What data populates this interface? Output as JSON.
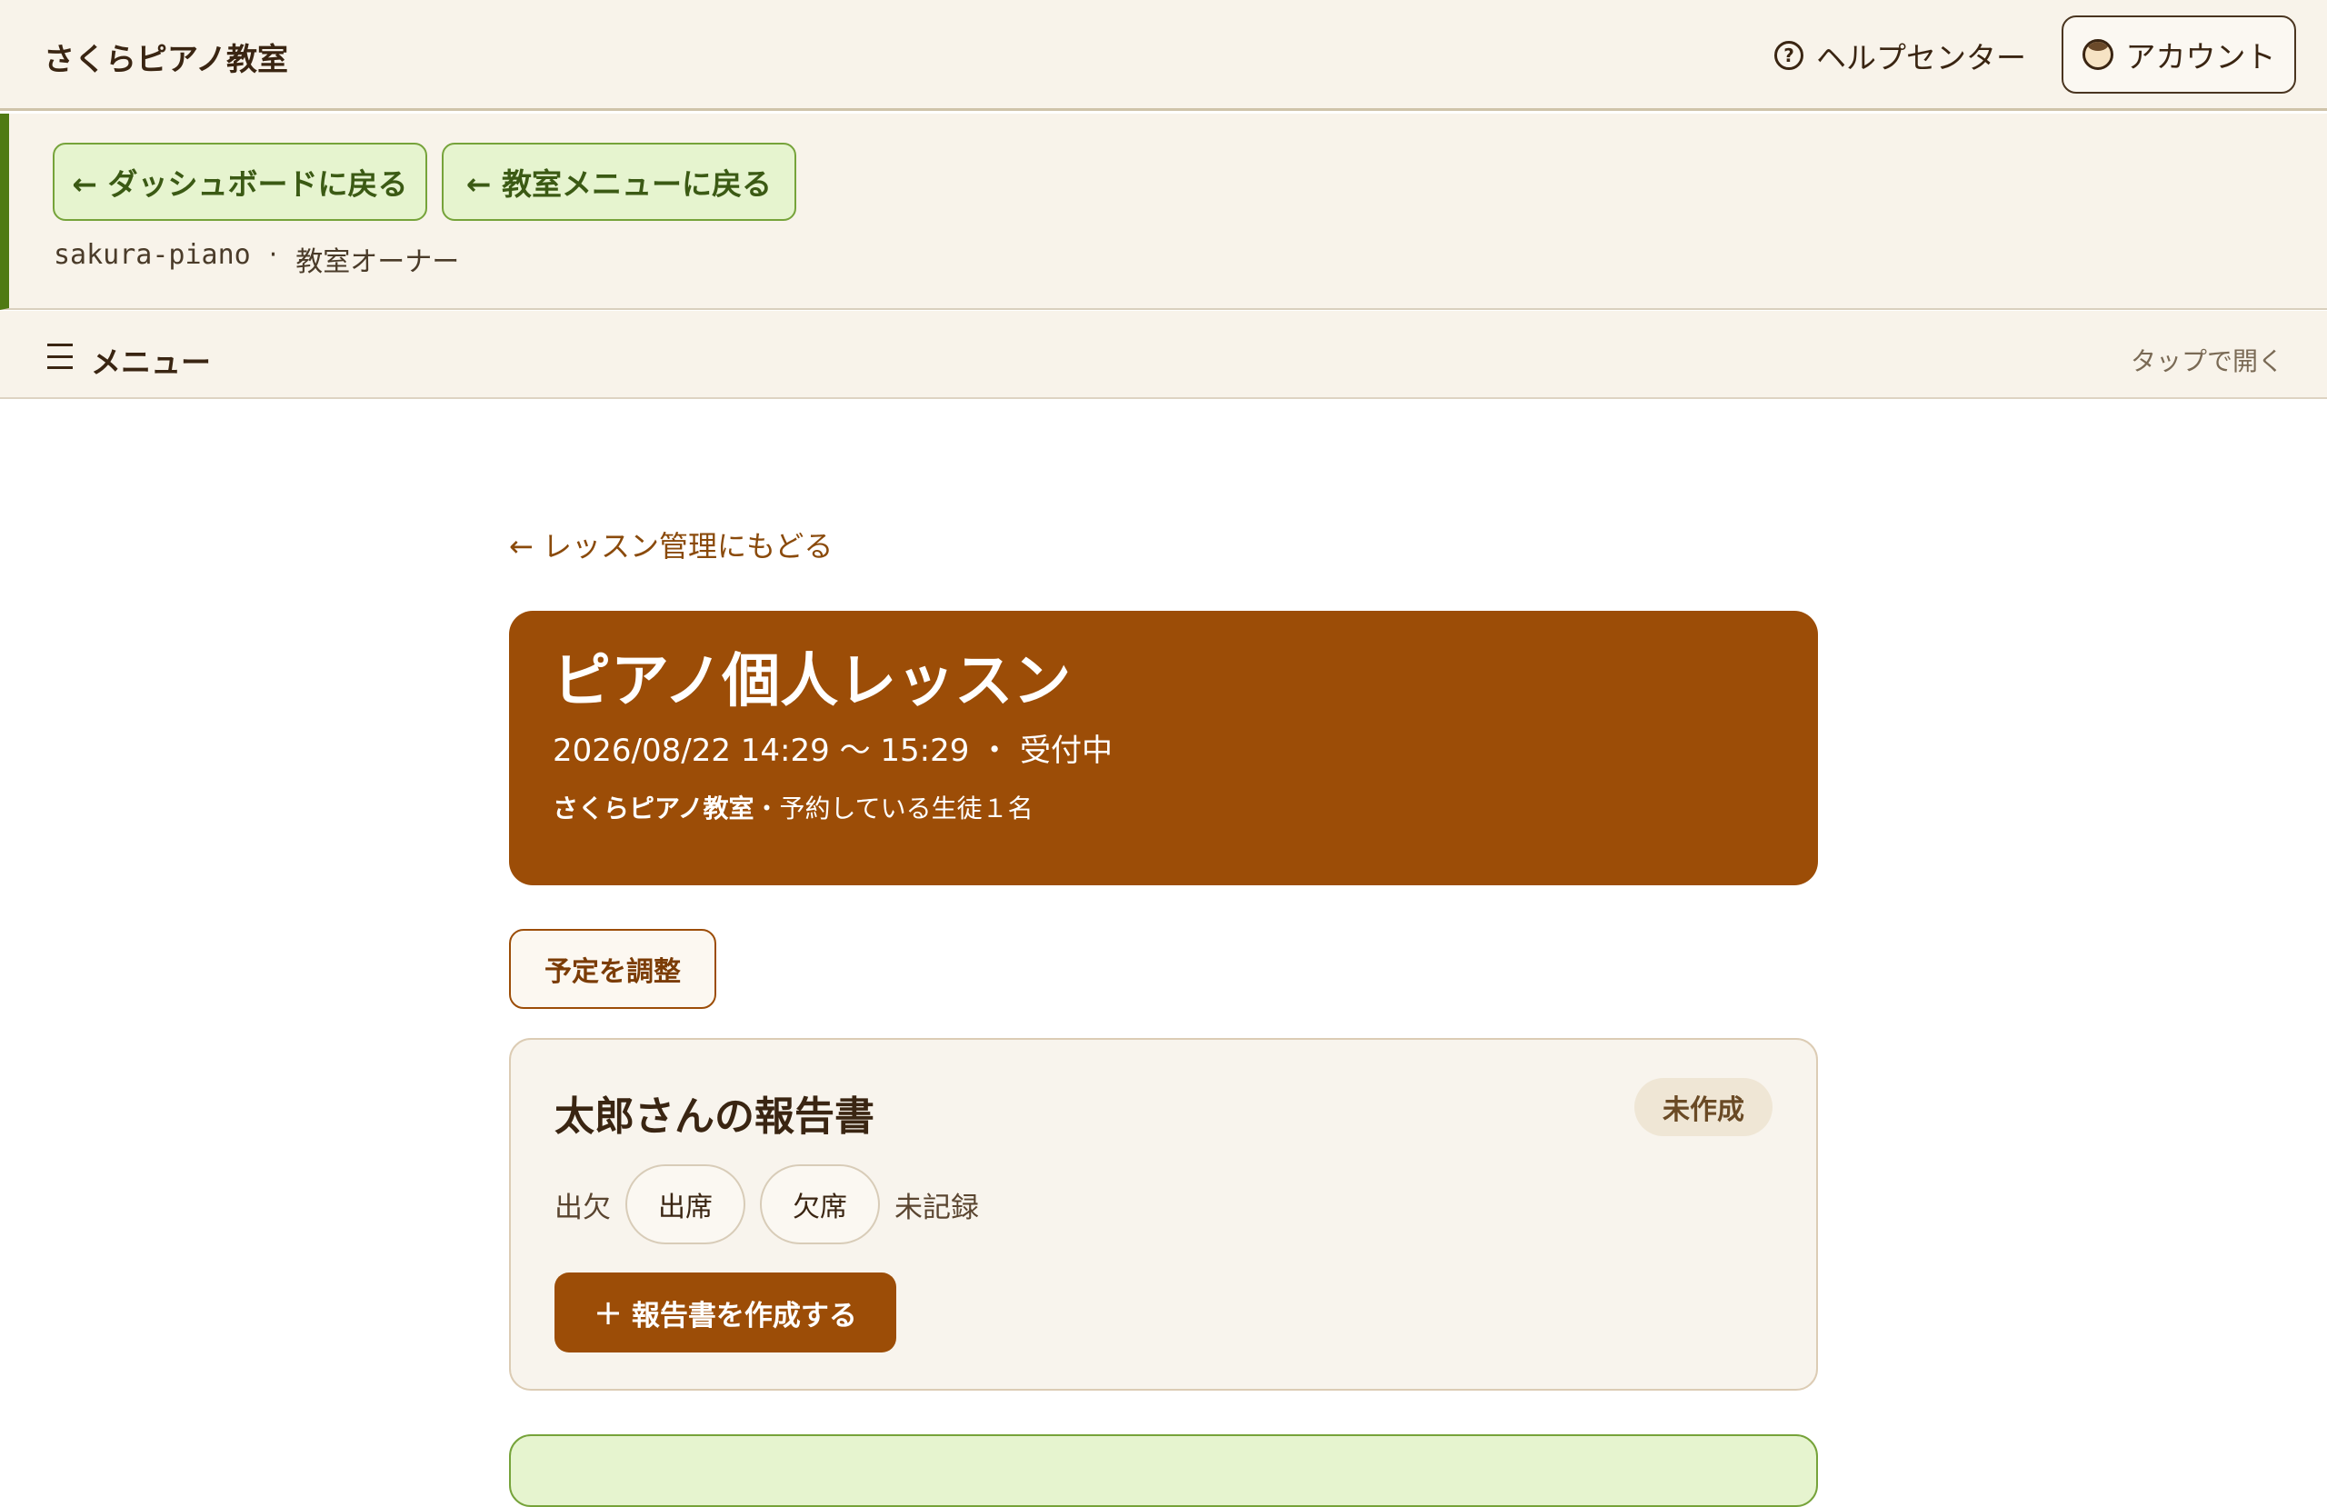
{
  "header": {
    "site_title": "さくらピアノ教室",
    "help_label": "ヘルプセンター",
    "help_icon": "?",
    "account_label": "アカウント"
  },
  "subnav": {
    "back_dashboard": "← ダッシュボードに戻る",
    "back_menu": "← 教室メニューに戻る",
    "school_id": "sakura-piano",
    "separator": "·",
    "role": "教室オーナー"
  },
  "menu": {
    "label": "メニュー",
    "hint": "タップで開く"
  },
  "page": {
    "back_link": "← レッスン管理にもどる"
  },
  "lesson": {
    "title": "ピアノ個人レッスン",
    "datetime": "2026/08/22 14:29 〜 15:29",
    "dot": "・",
    "status": "受付中",
    "school_name": "さくらピアノ教室",
    "students_text": "・予約している生徒１名"
  },
  "actions": {
    "adjust_label": "予定を調整"
  },
  "report": {
    "title": "太郎さんの報告書",
    "badge": "未作成",
    "attendance_label": "出欠",
    "present_label": "出席",
    "absent_label": "欠席",
    "attendance_status": "未記録",
    "create_icon": "+",
    "create_label": "報告書を作成する"
  },
  "colors": {
    "brand_brown": "#9c4d07",
    "accent_green": "#4f7a13",
    "light_green": "#e6f4cf",
    "cream": "#f8f3ea"
  }
}
